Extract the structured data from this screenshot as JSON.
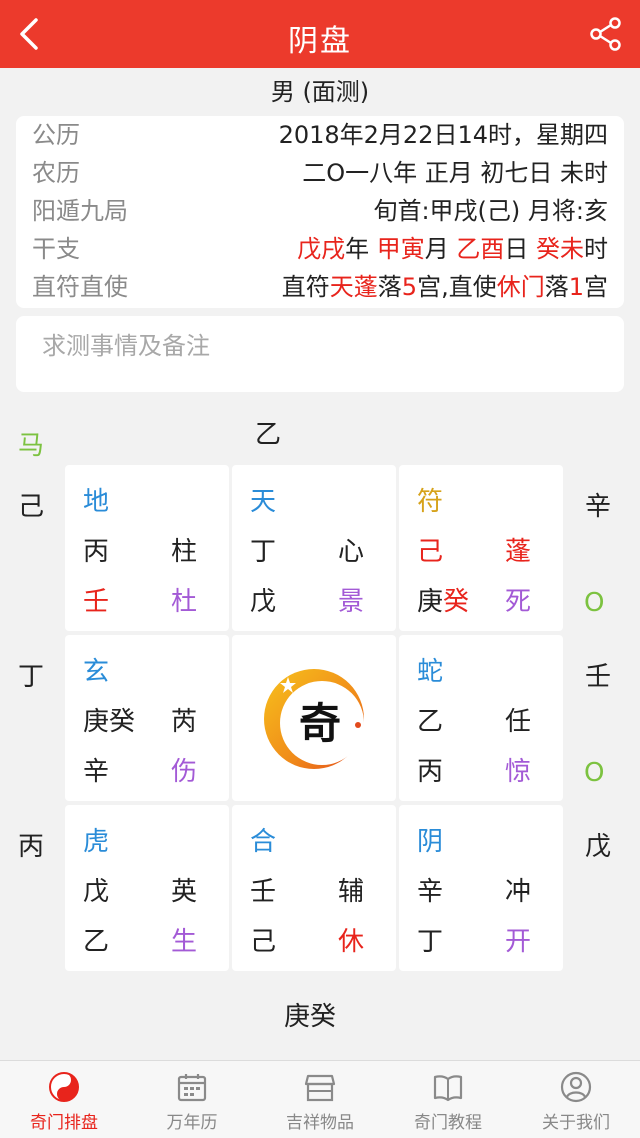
{
  "header": {
    "title": "阴盘"
  },
  "subtitle": "男 (面测)",
  "info": {
    "gongli": {
      "label": "公历",
      "value": "2018年2月22日14时，星期四"
    },
    "nongli": {
      "label": "农历",
      "value": "二O一八年 正月 初七日 未时"
    },
    "ju": {
      "label": "阳遁九局",
      "value": "旬首:甲戌(己) 月将:亥"
    },
    "ganzhi": {
      "label": "干支",
      "year": "戊戌",
      "year_suffix": "年",
      "month": "甲寅",
      "month_suffix": "月",
      "day": "乙酉",
      "day_suffix": "日",
      "hour": "癸未",
      "hour_suffix": "时"
    },
    "zhifu": {
      "label": "直符直使",
      "p1": "直符",
      "star": "天蓬",
      "p2": "落",
      "num1": "5",
      "p3": "宫,直使",
      "door": "休门",
      "p4": "落",
      "num2": "1",
      "p5": "宫"
    }
  },
  "note": {
    "placeholder": "求测事情及备注"
  },
  "outer": {
    "top": "乙",
    "ma": "马",
    "left": [
      "己",
      "丁",
      "丙"
    ],
    "right": [
      "辛",
      "壬",
      "戊"
    ],
    "right_marks": [
      "O",
      "O"
    ],
    "bottom": "庚癸"
  },
  "grid": [
    {
      "god": "地",
      "r1a": "丙",
      "r1b": "柱",
      "r2a": "壬",
      "r2b": "杜"
    },
    {
      "god": "天",
      "r1a": "丁",
      "r1b": "心",
      "r2a": "戊",
      "r2b": "景"
    },
    {
      "god": "符",
      "r1a": "己",
      "r1b": "蓬",
      "r2a": "庚",
      "r2a2": "癸",
      "r2b": "死"
    },
    {
      "god": "玄",
      "r1a": "庚癸",
      "r1b": "芮",
      "r2a": "辛",
      "r2b": "伤"
    },
    {
      "god": "蛇",
      "r1a": "乙",
      "r1b": "任",
      "r2a": "丙",
      "r2b": "惊"
    },
    {
      "god": "虎",
      "r1a": "戊",
      "r1b": "英",
      "r2a": "乙",
      "r2b": "生"
    },
    {
      "god": "合",
      "r1a": "壬",
      "r1b": "辅",
      "r2a": "己",
      "r2b": "休"
    },
    {
      "god": "阴",
      "r1a": "辛",
      "r1b": "冲",
      "r2a": "丁",
      "r2b": "开"
    }
  ],
  "logo_char": "奇",
  "nav": [
    {
      "label": "奇门排盘",
      "icon": "yin-yang-icon"
    },
    {
      "label": "万年历",
      "icon": "calendar-icon"
    },
    {
      "label": "吉祥物品",
      "icon": "shop-icon"
    },
    {
      "label": "奇门教程",
      "icon": "book-icon"
    },
    {
      "label": "关于我们",
      "icon": "user-icon"
    }
  ],
  "colors": {
    "primary": "#ec3a2c",
    "god_blue": "#2a8cd8",
    "god_yellow": "#d6a21a",
    "door_purple": "#a35ad6",
    "mark_green": "#7cc240"
  }
}
